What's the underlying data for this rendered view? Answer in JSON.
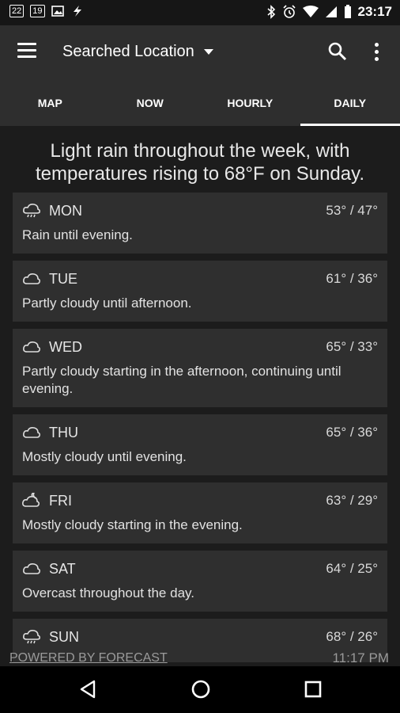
{
  "status": {
    "badge1": "22",
    "badge2": "19",
    "time": "23:17"
  },
  "app": {
    "title": "Searched Location"
  },
  "tabs": [
    {
      "label": "MAP"
    },
    {
      "label": "NOW"
    },
    {
      "label": "HOURLY"
    },
    {
      "label": "DAILY"
    }
  ],
  "summary": "Light rain throughout the week, with temperatures rising to 68°F on Sunday.",
  "days": [
    {
      "day": "MON",
      "temps": "53° / 47°",
      "desc": "Rain until evening.",
      "icon": "rain-icon"
    },
    {
      "day": "TUE",
      "temps": "61° / 36°",
      "desc": "Partly cloudy until afternoon.",
      "icon": "cloud-icon"
    },
    {
      "day": "WED",
      "temps": "65° / 33°",
      "desc": "Partly cloudy starting in the afternoon, continuing until evening.",
      "icon": "cloud-icon"
    },
    {
      "day": "THU",
      "temps": "65° / 36°",
      "desc": "Mostly cloudy until evening.",
      "icon": "cloud-icon"
    },
    {
      "day": "FRI",
      "temps": "63° / 29°",
      "desc": "Mostly cloudy starting in the evening.",
      "icon": "partly-cloudy-night-icon"
    },
    {
      "day": "SAT",
      "temps": "64° / 25°",
      "desc": "Overcast throughout the day.",
      "icon": "cloud-icon"
    },
    {
      "day": "SUN",
      "temps": "68° / 26°",
      "desc": "",
      "icon": "rain-icon"
    }
  ],
  "footer": {
    "powered": "POWERED BY FORECAST",
    "updated": "11:17 PM"
  }
}
